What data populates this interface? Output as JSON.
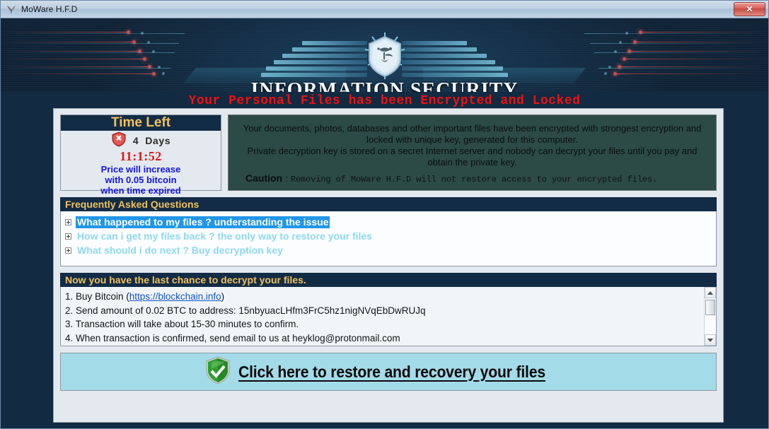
{
  "window": {
    "title": "MoWare H.F.D",
    "icon": "moth-icon",
    "close_label": "✕"
  },
  "banner": {
    "title": "INFORMATION SECURITY",
    "emblem": "winged-shield-emblem"
  },
  "warning": {
    "text": "Your Personal Files has been Encrypted and Locked",
    "color": "#ee1111"
  },
  "time_left": {
    "header": "Time Left",
    "header_color": "#f0c060",
    "alert_icon": "red-shield-x-icon",
    "days_value": "4",
    "days_unit": "Days",
    "timer": "11:1:52",
    "timer_color": "#e61414",
    "note_lines": [
      "Price will increase",
      "with 0.05 bitcoin",
      "when time expired"
    ],
    "note_color": "#1414e8"
  },
  "description": {
    "paragraphs": [
      "Your documents, photos, databases and other important files have been encrypted with strongest encryption and locked with unique key, generated for this computer.",
      "Private decryption key is stored on a secret Internet server and nobody can decrypt your files until you pay and obtain the private key."
    ],
    "caution_label": "Caution",
    "caution_separator": ":",
    "caution_text": "Removing of MoWare H.F.D will not restore access to your encrypted files.",
    "background": "#2c4a46"
  },
  "faq": {
    "header": "Frequently Asked Questions",
    "items": [
      {
        "label": "What happened to my files ? understanding  the issue",
        "selected": true
      },
      {
        "label": "How can i get my files back ? the only way to restore your files",
        "selected": false
      },
      {
        "label": "What should i do next ? Buy decryption key",
        "selected": false
      }
    ],
    "selected_bg": "#2196e8",
    "item_color": "#8ed8ee"
  },
  "instructions": {
    "header": "Now you have the last chance to decrypt your files.",
    "lines": [
      {
        "pre": "1. Buy Bitcoin (",
        "link": "https://blockchain.info",
        "post": ")"
      },
      {
        "pre": "2. Send amount of 0.02 BTC to address: 15nbyuacLHfm3FrC5hz1nigNVqEbDwRUJq",
        "link": "",
        "post": ""
      },
      {
        "pre": "3. Transaction will take about 15-30 minutes to confirm.",
        "link": "",
        "post": ""
      },
      {
        "pre": "4. When transaction is confirmed, send email to us at heyklog@protonmail.com",
        "link": "",
        "post": ""
      }
    ],
    "bitcoin_address": "15nbyuacLHfm3FrC5hz1nigNVqEbDwRUJq",
    "btc_amount": "0.02",
    "contact_email": "heyklog@protonmail.com"
  },
  "restore": {
    "label": "Click here to restore and recovery your files",
    "icon": "green-shield-check-icon",
    "background": "#a3dbe8"
  }
}
